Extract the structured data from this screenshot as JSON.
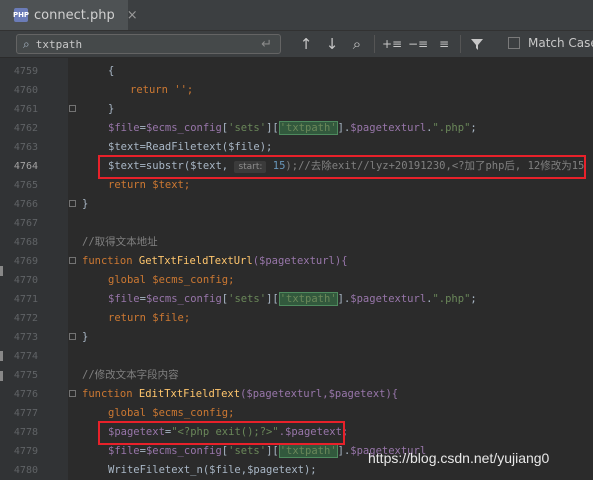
{
  "tab": {
    "icon_text": "PHP",
    "label": "connect.php",
    "close": "×"
  },
  "find": {
    "query": "txtpath",
    "match_case_label": "Match Case"
  },
  "lines": [
    "4759",
    "4760",
    "4761",
    "4762",
    "4763",
    "4764",
    "4765",
    "4766",
    "4767",
    "4768",
    "4769",
    "4770",
    "4771",
    "4772",
    "4773",
    "4774",
    "4775",
    "4776",
    "4777",
    "4778",
    "4779",
    "4780"
  ],
  "code": {
    "l4759": "{",
    "l4760": "return '';",
    "l4761": "}",
    "l4762": {
      "a": "$file",
      "b": "=",
      "c": "$ecms_config",
      "d": "[",
      "e": "'sets'",
      "f": "][",
      "g": "'txtpath'",
      "h": "].",
      "i": "$pagetexturl",
      ".": ".",
      "j": "\".php\"",
      "k": ";"
    },
    "l4763": "$text=ReadFiletext($file);",
    "l4764": {
      "pre": "$text=substr($text,",
      "hint": "start:",
      "num": "15",
      "post": ");//去除exit//lyz+20191230,<?加了php后, 12修改为15"
    },
    "l4765": "return $text;",
    "l4766": "}",
    "l4768": "//取得文本地址",
    "l4769": {
      "kw": "function ",
      "fn": "GetTxtFieldTextUrl",
      "arg": "($pagetexturl){"
    },
    "l4770": "global $ecms_config;",
    "l4772": "return $file;",
    "l4773": "}",
    "l4775": "//修改文本字段内容",
    "l4776": {
      "kw": "function ",
      "fn": "EditTxtFieldText",
      "arg": "($pagetexturl,$pagetext){"
    },
    "l4777": "global $ecms_config;",
    "l4778": {
      "var": "$pagetext",
      "eq": "=",
      "str": "\"<?php exit();?>\"",
      "rest": ".$pagetext;"
    },
    "l4780": "WriteFiletext_n($file,$pagetext);"
  },
  "watermark": "https://blog.csdn.net/yujiang0"
}
